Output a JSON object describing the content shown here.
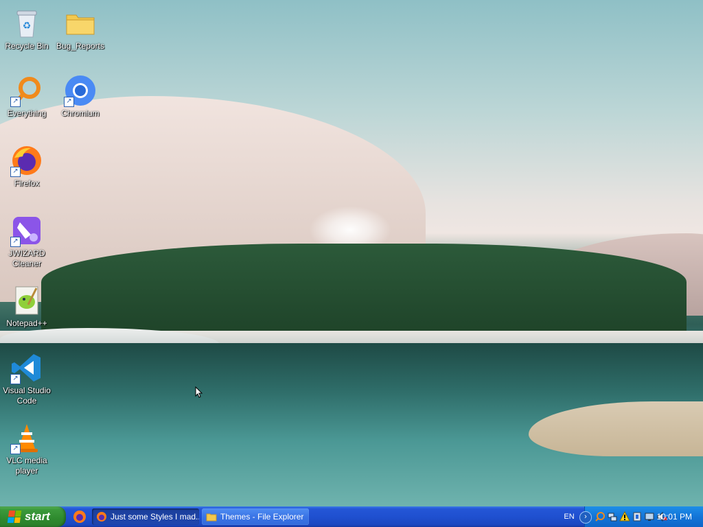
{
  "desktop": {
    "icons": [
      {
        "label": "Recycle Bin",
        "icon": "recycle-bin-icon"
      },
      {
        "label": "Bug_Reports",
        "icon": "folder-icon"
      },
      {
        "label": "Everything",
        "icon": "everything-search-icon"
      },
      {
        "label": "Chromium",
        "icon": "chromium-icon"
      },
      {
        "label": "Firefox",
        "icon": "firefox-icon"
      },
      {
        "label": "JWIZARD Cleaner",
        "icon": "jwizard-cleaner-icon"
      },
      {
        "label": "Notepad++",
        "icon": "notepadplusplus-icon"
      },
      {
        "label": "Visual Studio Code",
        "icon": "vscode-icon"
      },
      {
        "label": "VLC media player",
        "icon": "vlc-icon"
      }
    ]
  },
  "taskbar": {
    "start_label": "start",
    "quicklaunch": [
      {
        "icon": "firefox-icon"
      }
    ],
    "tasks": [
      {
        "label": "Just some Styles I mad...",
        "icon": "firefox-icon",
        "active": true
      },
      {
        "label": "Themes - File Explorer",
        "icon": "folder-icon",
        "active": false
      }
    ],
    "language": "EN",
    "tray_icons": [
      "chevron-icon",
      "everything-search-icon",
      "network-icon",
      "warning-icon",
      "safely-remove-icon",
      "display-icon",
      "volume-muted-icon"
    ],
    "clock": "10:01 PM"
  },
  "colors": {
    "taskbar_blue": "#2456d6",
    "start_green": "#3c9a3c",
    "tray_blue": "#1375d8"
  }
}
